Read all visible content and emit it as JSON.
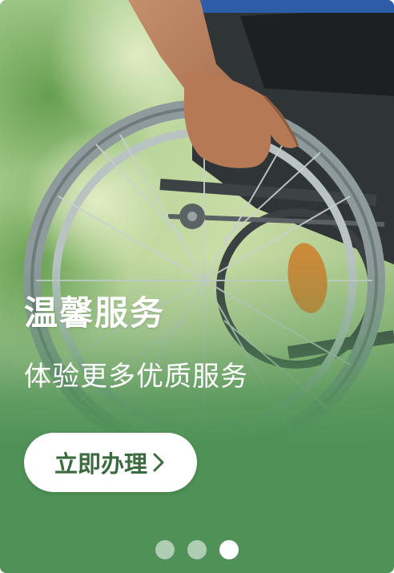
{
  "banner": {
    "title": "温馨服务",
    "subtitle": "体验更多优质服务",
    "cta_label": "立即办理",
    "cta_icon": "chevron-right-icon",
    "background_image": "wheelchair-wheel-photo",
    "colors": {
      "theme_green": "#4f9157",
      "cta_text": "#3a6b3f",
      "cta_background": "#ffffff"
    }
  },
  "pagination": {
    "total": 3,
    "active_index": 2
  }
}
